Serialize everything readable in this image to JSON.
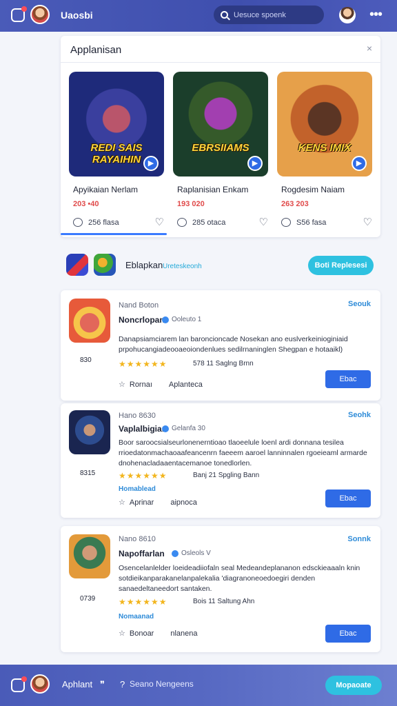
{
  "header": {
    "title": "Uaosbi",
    "search_placeholder": "Uesuce spoenk",
    "more_glyph": "•••"
  },
  "featured": {
    "title": "Applanisan",
    "close_glyph": "×",
    "cards": [
      {
        "art_text": "REDI SAIS RAYAIHIN",
        "name": "Apyikaian Nerlam",
        "price": "203 •40",
        "comments": "256 flasa"
      },
      {
        "art_text": "EBRSIIAMS",
        "name": "Raplanisian Enkam",
        "price": "193 020",
        "comments": "285 otaca"
      },
      {
        "art_text": "KENS IMIX",
        "name": "Rogdesim Naiam",
        "price": "263 203",
        "comments": "S56 fasa"
      }
    ]
  },
  "mid": {
    "label": "Eblapkan",
    "sublabel": "Ureteskeonh",
    "button": "Boti Replesesi"
  },
  "posts": [
    {
      "kicker": "Nand Boton",
      "action": "Seouk",
      "name": "Noncrlopan",
      "handle": "Ooleuto  1",
      "desc": "Danapsiamciarem lan baroncioncade Nosekan ano euslverkeinioginiaid prpohucangiadeooaeoiondenlues sedilrnaninglen Shegpan e hotaaikl)",
      "score": "830",
      "stars": "★★★★★★",
      "rating": "578 11  Saglng Brnn",
      "link": "",
      "foot1": "Rornaı",
      "foot2": "Aplanteca",
      "button": "Ebac"
    },
    {
      "kicker": "Hano 8630",
      "action": "Seohk",
      "name": "Vaplalbigian",
      "handle": "Gelanfa  30",
      "desc": "Boor saroocsialseurlonenerntioao tlaoeelule loenl ardi donnana tesilea rrioedatonmachaoaafeancenrn faeeem aaroel lanninnalen rgoeieaml armarde dnohenacladaaentacemanoe tonedlorlen.",
      "score": "8315",
      "stars": "★★★★★★",
      "rating": "Banj 21  Spgling Bann",
      "link": "Homablead",
      "foot1": "Aprinar",
      "foot2": "aipnoca",
      "button": "Ebac"
    },
    {
      "kicker": "Nano 8610",
      "action": "Sonnk",
      "name": "Napoffarlan",
      "handle": "Osleols  V",
      "desc": "Osencelanlelder loeideadiiofaln seal Medeandeplananon edsckieaaaln knin sotdieikanparakanelanpalekalia 'diagranoneoedoegiri denden sanaedeltaneedort santaken.",
      "score": "0739",
      "stars": "★★★★★★",
      "rating": "Bois 11  Saltung Ahn",
      "link": "Nomaanad",
      "foot1": "Bonoar",
      "foot2": "nlanena",
      "button": "Ebac"
    }
  ],
  "footer": {
    "label": "Aphlant",
    "quote": "❞",
    "question": "?",
    "sub": "Seano Nengeens",
    "button": "Mopaoate"
  }
}
